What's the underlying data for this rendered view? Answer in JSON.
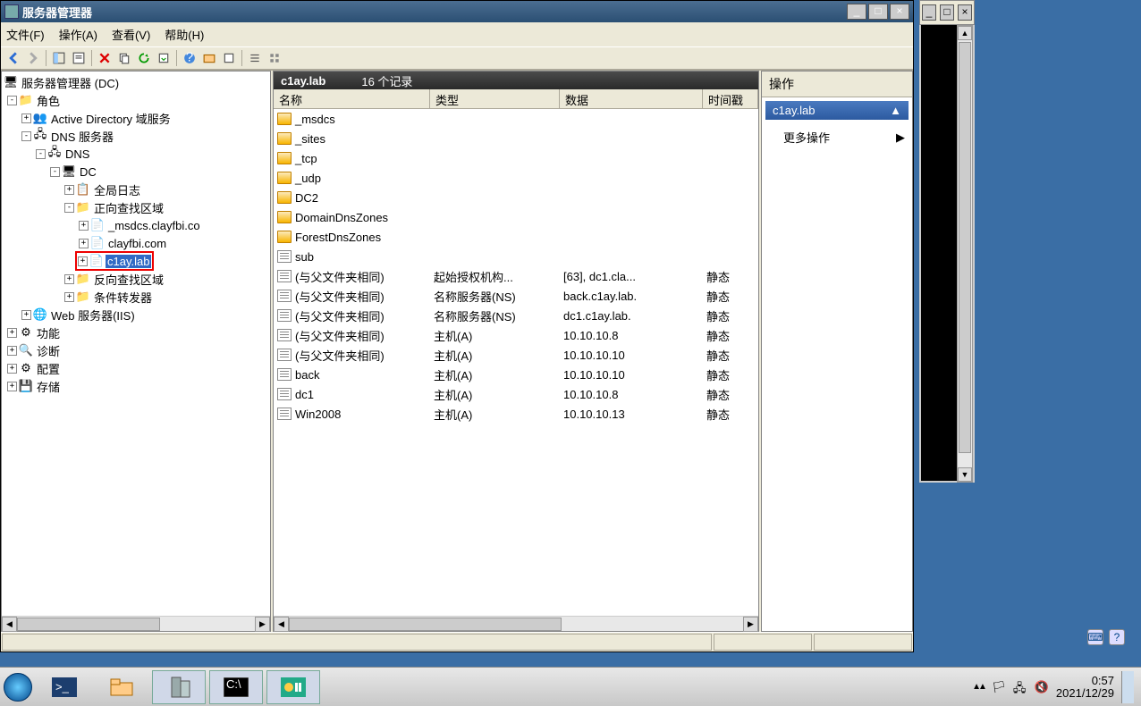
{
  "window": {
    "title": "服务器管理器"
  },
  "menu": {
    "file": "文件(F)",
    "action": "操作(A)",
    "view": "查看(V)",
    "help": "帮助(H)"
  },
  "tree": {
    "root": "服务器管理器 (DC)",
    "roles": "角色",
    "ad": "Active Directory 域服务",
    "dnssrv": "DNS 服务器",
    "dns": "DNS",
    "dc": "DC",
    "globallog": "全局日志",
    "fwd": "正向查找区域",
    "zone_msdcs": "_msdcs.clayfbi.co",
    "zone_clayfbi": "clayfbi.com",
    "zone_clay": "c1ay.lab",
    "rev": "反向查找区域",
    "cond": "条件转发器",
    "iis": "Web 服务器(IIS)",
    "features": "功能",
    "diag": "诊断",
    "config": "配置",
    "storage": "存储"
  },
  "list": {
    "header_zone": "c1ay.lab",
    "header_count": "16 个记录",
    "cols": {
      "name": "名称",
      "type": "类型",
      "data": "数据",
      "ts": "时间戳"
    },
    "rows": [
      {
        "icon": "folder",
        "name": "_msdcs",
        "type": "",
        "data": "",
        "ts": ""
      },
      {
        "icon": "folder",
        "name": "_sites",
        "type": "",
        "data": "",
        "ts": ""
      },
      {
        "icon": "folder",
        "name": "_tcp",
        "type": "",
        "data": "",
        "ts": ""
      },
      {
        "icon": "folder",
        "name": "_udp",
        "type": "",
        "data": "",
        "ts": ""
      },
      {
        "icon": "folder",
        "name": "DC2",
        "type": "",
        "data": "",
        "ts": ""
      },
      {
        "icon": "folder",
        "name": "DomainDnsZones",
        "type": "",
        "data": "",
        "ts": ""
      },
      {
        "icon": "folder",
        "name": "ForestDnsZones",
        "type": "",
        "data": "",
        "ts": ""
      },
      {
        "icon": "record",
        "name": "sub",
        "type": "",
        "data": "",
        "ts": ""
      },
      {
        "icon": "record",
        "name": "(与父文件夹相同)",
        "type": "起始授权机构...",
        "data": "[63], dc1.cla...",
        "ts": "静态"
      },
      {
        "icon": "record",
        "name": "(与父文件夹相同)",
        "type": "名称服务器(NS)",
        "data": "back.c1ay.lab.",
        "ts": "静态"
      },
      {
        "icon": "record",
        "name": "(与父文件夹相同)",
        "type": "名称服务器(NS)",
        "data": "dc1.c1ay.lab.",
        "ts": "静态"
      },
      {
        "icon": "record",
        "name": "(与父文件夹相同)",
        "type": "主机(A)",
        "data": "10.10.10.8",
        "ts": "静态"
      },
      {
        "icon": "record",
        "name": "(与父文件夹相同)",
        "type": "主机(A)",
        "data": "10.10.10.10",
        "ts": "静态"
      },
      {
        "icon": "record",
        "name": "back",
        "type": "主机(A)",
        "data": "10.10.10.10",
        "ts": "静态"
      },
      {
        "icon": "record",
        "name": "dc1",
        "type": "主机(A)",
        "data": "10.10.10.8",
        "ts": "静态"
      },
      {
        "icon": "record",
        "name": "Win2008",
        "type": "主机(A)",
        "data": "10.10.10.13",
        "ts": "静态"
      }
    ]
  },
  "actions": {
    "title": "操作",
    "sub": "c1ay.lab",
    "more": "更多操作"
  },
  "tray": {
    "time": "0:57",
    "date": "2021/12/29"
  }
}
